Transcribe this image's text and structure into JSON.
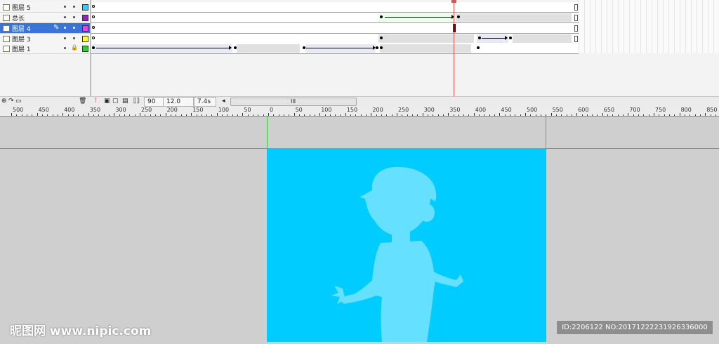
{
  "layers": [
    {
      "name": "图层 5",
      "color": "#33ccff",
      "selected": false
    },
    {
      "name": "总长",
      "color": "#8b2bb3",
      "selected": false
    },
    {
      "name": "图层 4",
      "color": "#ff33ff",
      "selected": true
    },
    {
      "name": "图层 3",
      "color": "#ffff33",
      "selected": false
    },
    {
      "name": "图层 1",
      "color": "#33cc33",
      "selected": false
    }
  ],
  "toolbar": {
    "frame": "90",
    "fps": "12.0 fps",
    "time": "7.4s",
    "scroll_thumb": "III"
  },
  "ruler": {
    "labels": [
      "500",
      "450",
      "400",
      "350",
      "300",
      "250",
      "200",
      "150",
      "100",
      "50",
      "0",
      "50",
      "100",
      "150",
      "200",
      "250",
      "300",
      "350",
      "400",
      "450",
      "500",
      "550",
      "600",
      "650",
      "700",
      "750",
      "800",
      "850"
    ]
  },
  "colors": {
    "stage": "#00ccff",
    "silhouette": "#66e0ff",
    "guide": "#32cd32",
    "playhead": "#d9534f"
  },
  "watermark": {
    "logo": "昵图网 www.nipic.com",
    "id": "ID:2206122 NO:20171222231926336000"
  }
}
